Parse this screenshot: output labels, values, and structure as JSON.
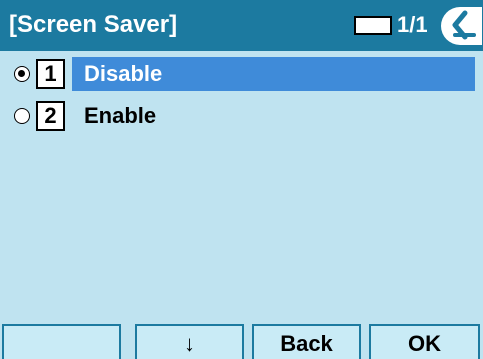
{
  "header": {
    "title": "[Screen Saver]",
    "page_indicator": "1/1",
    "back_icon": "back-arrow-icon"
  },
  "options": [
    {
      "number": "1",
      "label": "Disable",
      "selected": true
    },
    {
      "number": "2",
      "label": "Enable",
      "selected": false
    }
  ],
  "softkeys": {
    "key1": "",
    "key2": "↓",
    "key3": "Back",
    "key4": "OK"
  },
  "colors": {
    "header_bg": "#1c7aa0",
    "screen_bg": "#bfe3f0",
    "selection_bg": "#3f8bd9"
  }
}
